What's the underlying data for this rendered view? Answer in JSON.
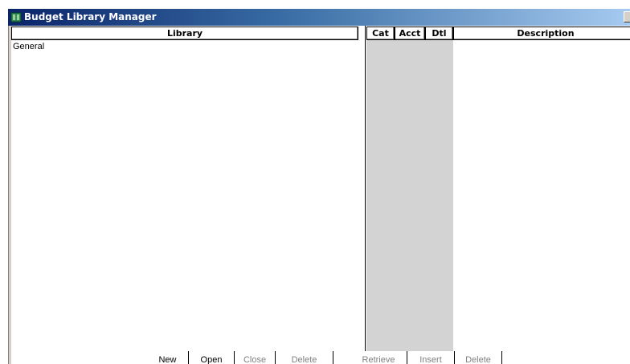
{
  "window": {
    "title": "Budget Library Manager",
    "icon": "app-icon",
    "titlebar_color_start": "#0a246a",
    "titlebar_color_end": "#a6caf0"
  },
  "library": {
    "header": "Library",
    "rows": [
      "General"
    ]
  },
  "detail": {
    "columns": {
      "cat": "Cat",
      "acct": "Acct",
      "dtl": "Dtl",
      "description": "Description"
    },
    "highlight_color": "#d3d3d3"
  },
  "buttons": {
    "library_new": "New",
    "library_open": "Open",
    "library_close": "Close",
    "library_delete": "Delete",
    "detail_retrieve": "Retrieve",
    "detail_insert": "Insert",
    "detail_delete": "Delete"
  }
}
